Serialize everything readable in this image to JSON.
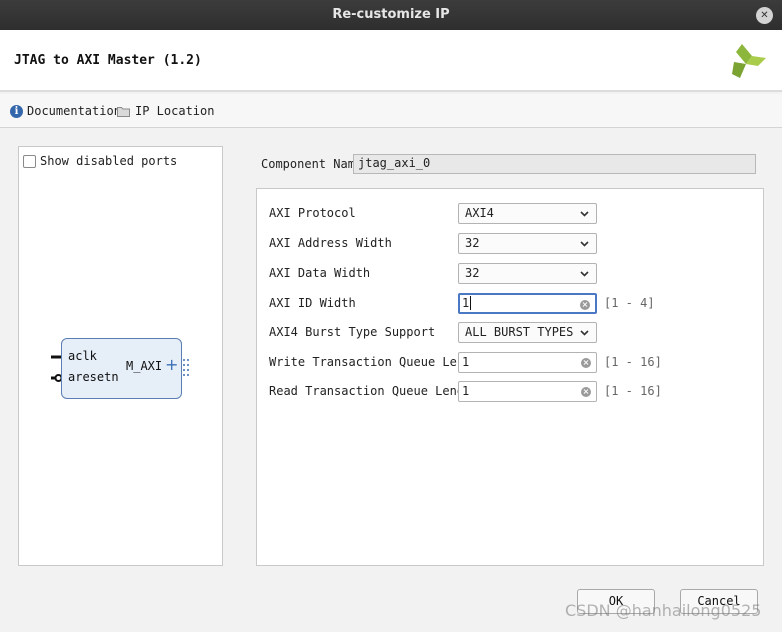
{
  "window": {
    "title": "Re-customize IP"
  },
  "header": {
    "title": "JTAG to AXI Master (1.2)"
  },
  "toolbar": {
    "documentation": "Documentation",
    "ip_location": "IP Location"
  },
  "left": {
    "show_disabled_ports": "Show disabled ports",
    "block": {
      "port_aclk": "aclk",
      "port_aresetn": "aresetn",
      "port_maxi": "M_AXI"
    }
  },
  "component": {
    "label": "Component Name",
    "value": "jtag_axi_0"
  },
  "params": [
    {
      "label": "AXI Protocol",
      "type": "select",
      "value": "AXI4"
    },
    {
      "label": "AXI Address Width",
      "type": "select",
      "value": "32"
    },
    {
      "label": "AXI Data Width",
      "type": "select",
      "value": "32"
    },
    {
      "label": "AXI ID Width",
      "type": "input",
      "value": "1",
      "range": "[1 - 4]"
    },
    {
      "label": "AXI4 Burst Type Support",
      "type": "select",
      "value": "ALL BURST TYPES"
    },
    {
      "label": "Write Transaction Queue Length",
      "type": "input",
      "value": "1",
      "range": "[1 - 16]"
    },
    {
      "label": "Read Transaction Queue Length",
      "type": "input",
      "value": "1",
      "range": "[1 - 16]"
    }
  ],
  "buttons": {
    "ok": "OK",
    "cancel": "Cancel"
  },
  "watermark": "CSDN @hanhailong0525",
  "colors": {
    "accent": "#4a78c2",
    "logo": "#8db63c",
    "titlebar": "#333333"
  }
}
